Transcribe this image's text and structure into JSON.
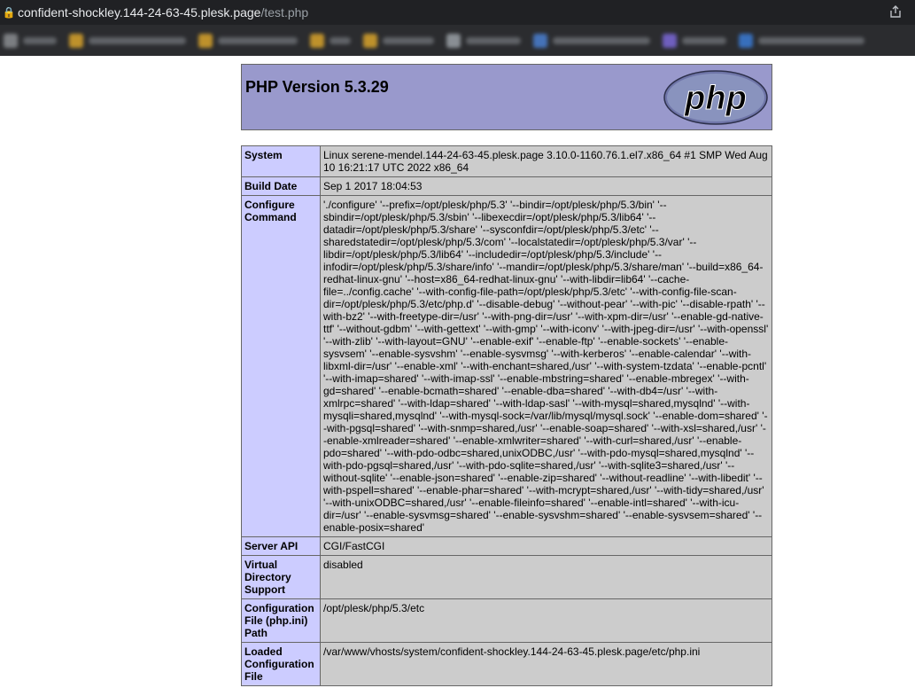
{
  "browser": {
    "url_host": "confident-shockley.144-24-63-45.plesk.page",
    "url_path": "/test.php",
    "lock_icon": "lock-icon",
    "share_icon": "share-icon"
  },
  "colors": {
    "header_bg": "#9999cc",
    "label_bg": "#ccccff",
    "value_bg": "#cccccc",
    "border": "#666666"
  },
  "header": {
    "title": "PHP Version 5.3.29",
    "logo_text": "php"
  },
  "rows": [
    {
      "label": "System",
      "value": "Linux serene-mendel.144-24-63-45.plesk.page 3.10.0-1160.76.1.el7.x86_64 #1 SMP Wed Aug 10 16:21:17 UTC 2022 x86_64"
    },
    {
      "label": "Build Date",
      "value": "Sep 1 2017 18:04:53"
    },
    {
      "label": "Configure Command",
      "value": "'./configure' '--prefix=/opt/plesk/php/5.3' '--bindir=/opt/plesk/php/5.3/bin' '--sbindir=/opt/plesk/php/5.3/sbin' '--libexecdir=/opt/plesk/php/5.3/lib64' '--datadir=/opt/plesk/php/5.3/share' '--sysconfdir=/opt/plesk/php/5.3/etc' '--sharedstatedir=/opt/plesk/php/5.3/com' '--localstatedir=/opt/plesk/php/5.3/var' '--libdir=/opt/plesk/php/5.3/lib64' '--includedir=/opt/plesk/php/5.3/include' '--infodir=/opt/plesk/php/5.3/share/info' '--mandir=/opt/plesk/php/5.3/share/man' '--build=x86_64-redhat-linux-gnu' '--host=x86_64-redhat-linux-gnu' '--with-libdir=lib64' '--cache-file=../config.cache' '--with-config-file-path=/opt/plesk/php/5.3/etc' '--with-config-file-scan-dir=/opt/plesk/php/5.3/etc/php.d' '--disable-debug' '--without-pear' '--with-pic' '--disable-rpath' '--with-bz2' '--with-freetype-dir=/usr' '--with-png-dir=/usr' '--with-xpm-dir=/usr' '--enable-gd-native-ttf' '--without-gdbm' '--with-gettext' '--with-gmp' '--with-iconv' '--with-jpeg-dir=/usr' '--with-openssl' '--with-zlib' '--with-layout=GNU' '--enable-exif' '--enable-ftp' '--enable-sockets' '--enable-sysvsem' '--enable-sysvshm' '--enable-sysvmsg' '--with-kerberos' '--enable-calendar' '--with-libxml-dir=/usr' '--enable-xml' '--with-enchant=shared,/usr' '--with-system-tzdata' '--enable-pcntl' '--with-imap=shared' '--with-imap-ssl' '--enable-mbstring=shared' '--enable-mbregex' '--with-gd=shared' '--enable-bcmath=shared' '--enable-dba=shared' '--with-db4=/usr' '--with-xmlrpc=shared' '--with-ldap=shared' '--with-ldap-sasl' '--with-mysql=shared,mysqlnd' '--with-mysqli=shared,mysqlnd' '--with-mysql-sock=/var/lib/mysql/mysql.sock' '--enable-dom=shared' '--with-pgsql=shared' '--with-snmp=shared,/usr' '--enable-soap=shared' '--with-xsl=shared,/usr' '--enable-xmlreader=shared' '--enable-xmlwriter=shared' '--with-curl=shared,/usr' '--enable-pdo=shared' '--with-pdo-odbc=shared,unixODBC,/usr' '--with-pdo-mysql=shared,mysqlnd' '--with-pdo-pgsql=shared,/usr' '--with-pdo-sqlite=shared,/usr' '--with-sqlite3=shared,/usr' '--without-sqlite' '--enable-json=shared' '--enable-zip=shared' '--without-readline' '--with-libedit' '--with-pspell=shared' '--enable-phar=shared' '--with-mcrypt=shared,/usr' '--with-tidy=shared,/usr' '--with-unixODBC=shared,/usr' '--enable-fileinfo=shared' '--enable-intl=shared' '--with-icu-dir=/usr' '--enable-sysvmsg=shared' '--enable-sysvshm=shared' '--enable-sysvsem=shared' '--enable-posix=shared'"
    },
    {
      "label": "Server API",
      "value": "CGI/FastCGI"
    },
    {
      "label": "Virtual Directory Support",
      "value": "disabled"
    },
    {
      "label": "Configuration File (php.ini) Path",
      "value": "/opt/plesk/php/5.3/etc"
    },
    {
      "label": "Loaded Configuration File",
      "value": "/var/www/vhosts/system/confident-shockley.144-24-63-45.plesk.page/etc/php.ini"
    }
  ]
}
